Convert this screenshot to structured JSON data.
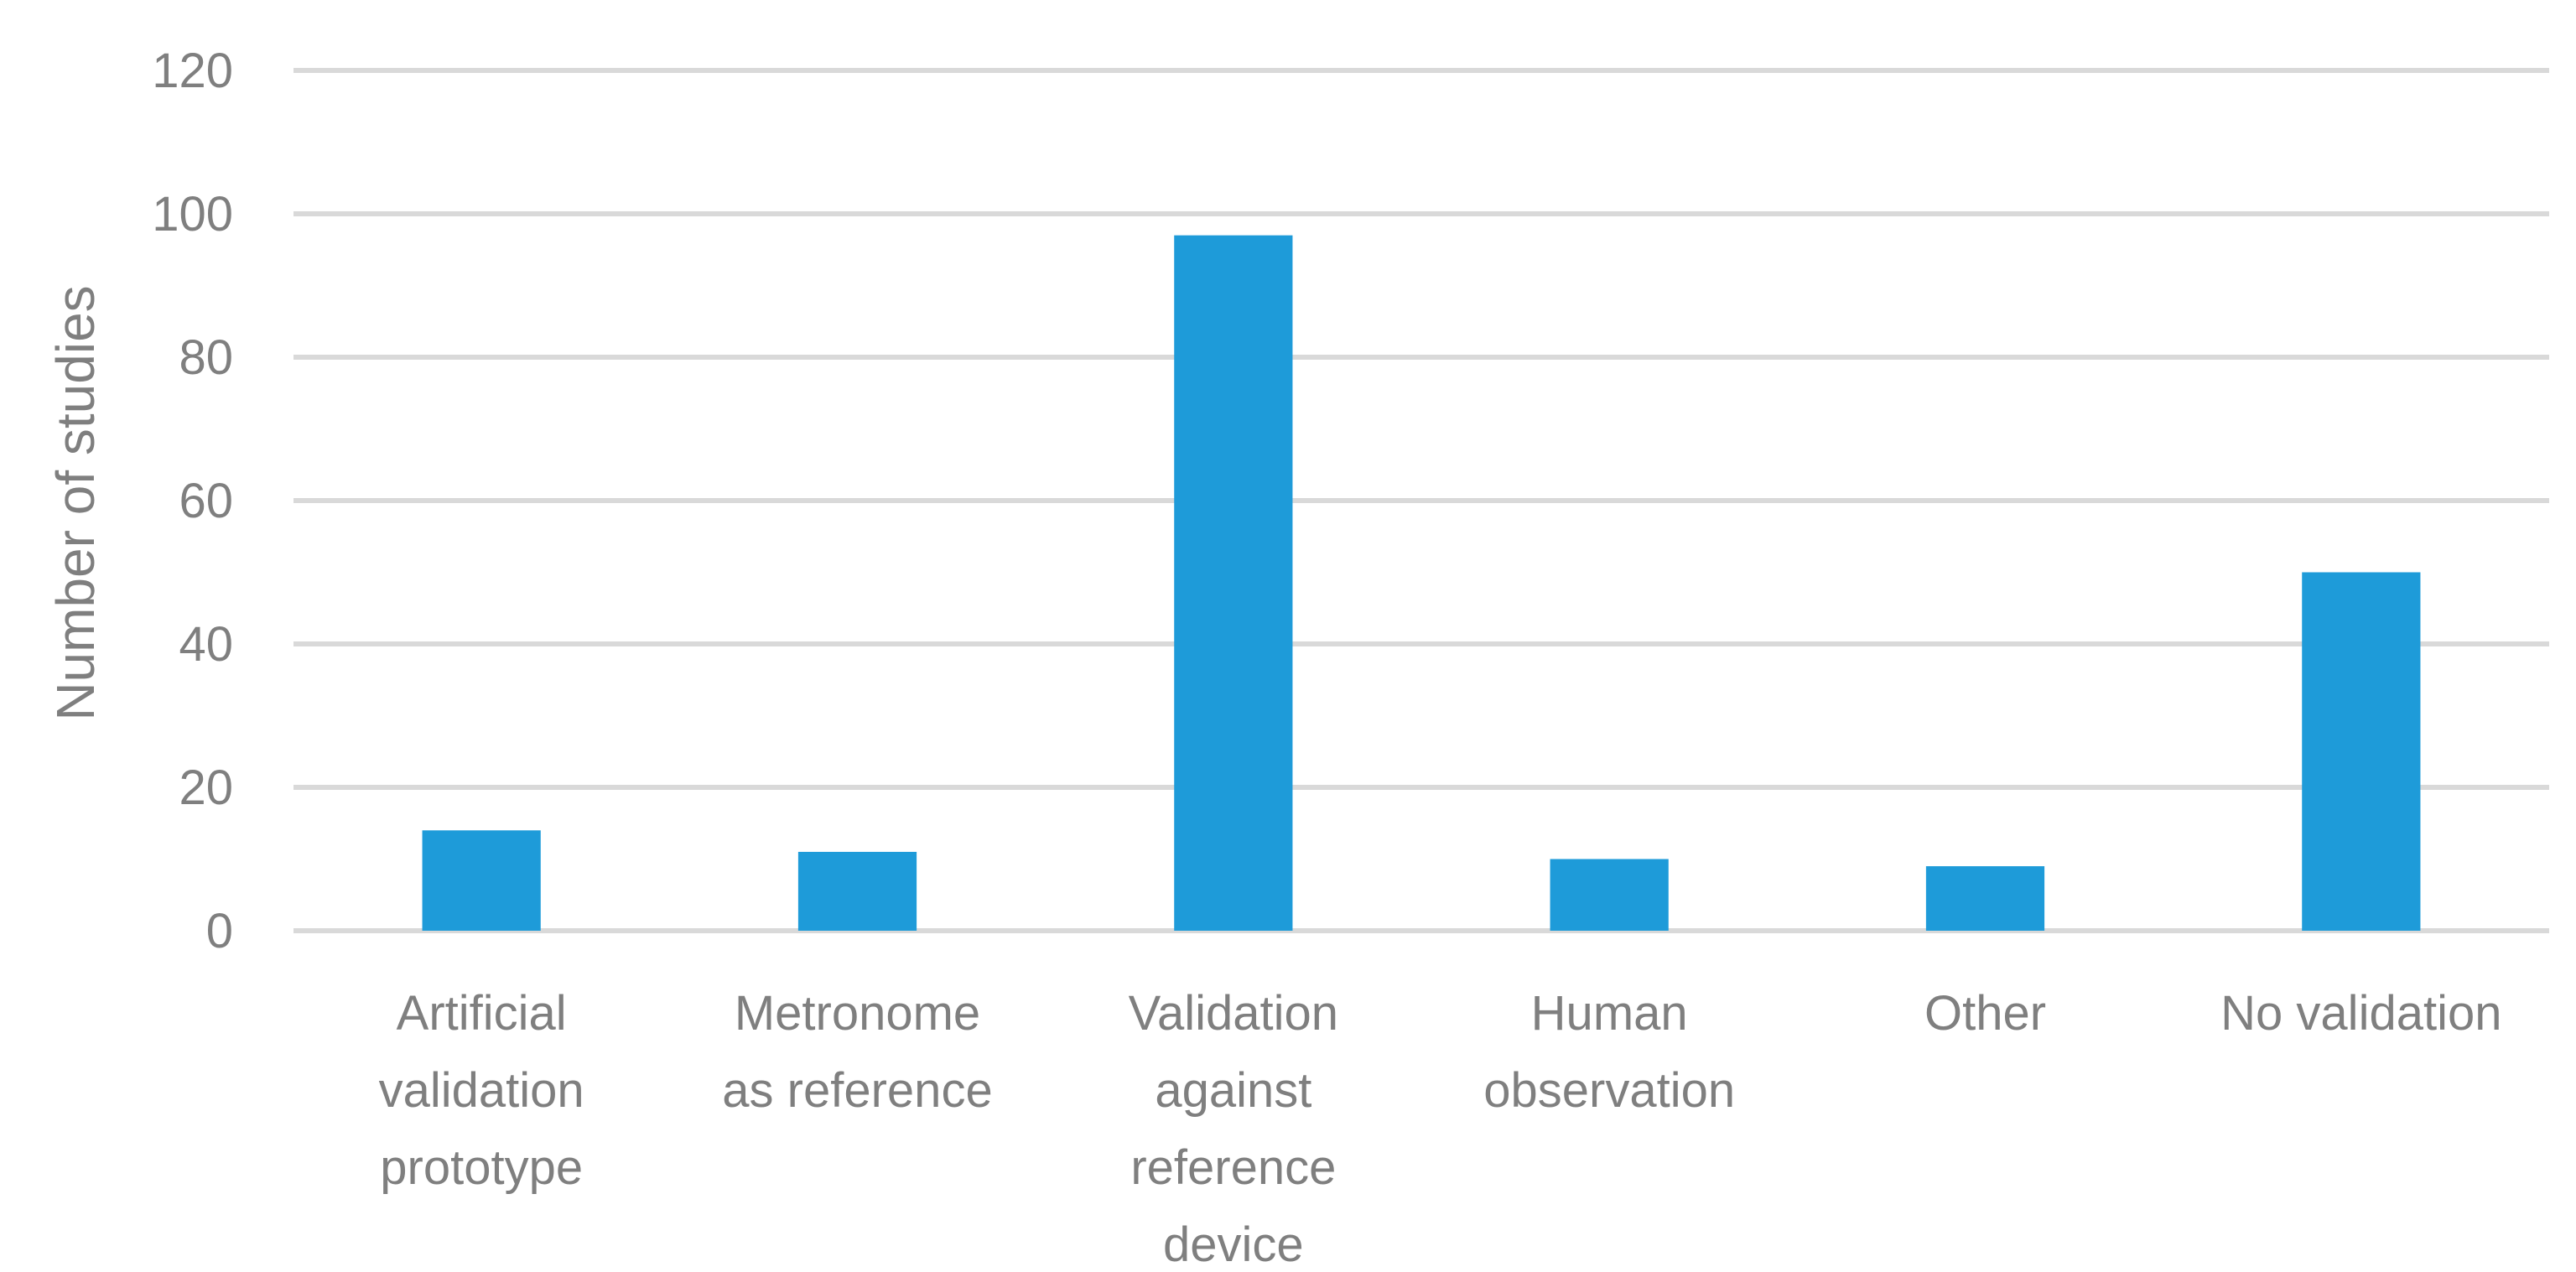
{
  "chart_data": {
    "type": "bar",
    "title": "",
    "xlabel": "",
    "ylabel": "Number of studies",
    "categories": [
      [
        "Artificial",
        "validation",
        "prototype"
      ],
      [
        "Metronome",
        "as reference"
      ],
      [
        "Validation",
        "against",
        "reference",
        "device"
      ],
      [
        "Human",
        "observation"
      ],
      [
        "Other"
      ],
      [
        "No validation"
      ]
    ],
    "category_names": [
      "Artificial validation prototype",
      "Metronome as reference",
      "Validation against reference device",
      "Human observation",
      "Other",
      "No validation"
    ],
    "values": [
      14,
      11,
      97,
      10,
      9,
      50
    ],
    "ylim": [
      0,
      120
    ],
    "yticks": [
      0,
      20,
      40,
      60,
      80,
      100,
      120
    ],
    "grid": true,
    "legend": "none",
    "colors": {
      "bar": "#1e9bd9",
      "gridline": "#d9d9d9",
      "text": "#7f7f7f"
    }
  }
}
